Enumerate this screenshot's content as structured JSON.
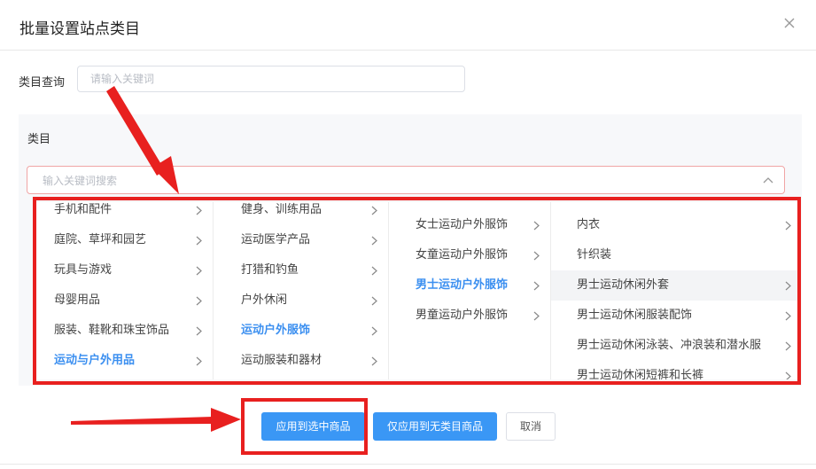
{
  "dialog": {
    "title": "批量设置站点类目",
    "close_icon": "close-icon"
  },
  "query": {
    "label": "类目查询",
    "placeholder": "请输入关键词",
    "value": ""
  },
  "panel": {
    "label": "类目",
    "search_placeholder": "输入关键词搜索",
    "search_value": ""
  },
  "cascader": {
    "col1": [
      {
        "label": "手机和配件",
        "has_children": true,
        "state": "normal"
      },
      {
        "label": "庭院、草坪和园艺",
        "has_children": true,
        "state": "normal"
      },
      {
        "label": "玩具与游戏",
        "has_children": true,
        "state": "normal"
      },
      {
        "label": "母婴用品",
        "has_children": true,
        "state": "normal"
      },
      {
        "label": "服装、鞋靴和珠宝饰品",
        "has_children": true,
        "state": "normal"
      },
      {
        "label": "运动与户外用品",
        "has_children": true,
        "state": "active"
      }
    ],
    "col2": [
      {
        "label": "健身、训练用品",
        "has_children": true,
        "state": "normal"
      },
      {
        "label": "运动医学产品",
        "has_children": true,
        "state": "normal"
      },
      {
        "label": "打猎和钓鱼",
        "has_children": true,
        "state": "normal"
      },
      {
        "label": "户外休闲",
        "has_children": true,
        "state": "normal"
      },
      {
        "label": "运动户外服饰",
        "has_children": true,
        "state": "active"
      },
      {
        "label": "运动服装和器材",
        "has_children": true,
        "state": "normal"
      }
    ],
    "col3": [
      {
        "label": "女士运动户外服饰",
        "has_children": true,
        "state": "normal"
      },
      {
        "label": "女童运动户外服饰",
        "has_children": true,
        "state": "normal"
      },
      {
        "label": "男士运动户外服饰",
        "has_children": true,
        "state": "active"
      },
      {
        "label": "男童运动户外服饰",
        "has_children": true,
        "state": "normal"
      }
    ],
    "col4": [
      {
        "label": "内衣",
        "has_children": true,
        "state": "normal"
      },
      {
        "label": "针织装",
        "has_children": false,
        "state": "normal"
      },
      {
        "label": "男士运动休闲外套",
        "has_children": true,
        "state": "hover"
      },
      {
        "label": "男士运动休闲服装配饰",
        "has_children": true,
        "state": "normal"
      },
      {
        "label": "男士运动休闲泳装、冲浪装和潜水服",
        "has_children": true,
        "state": "normal"
      },
      {
        "label": "男士运动休闲短裤和长裤",
        "has_children": true,
        "state": "normal"
      }
    ]
  },
  "buttons": {
    "apply_selected": "应用到选中商品",
    "apply_uncategorized": "仅应用到无类目商品",
    "cancel": "取消"
  },
  "colors": {
    "accent": "#3a97f5",
    "active_text": "#3b8ff0",
    "annotation_red": "#e8201f"
  }
}
